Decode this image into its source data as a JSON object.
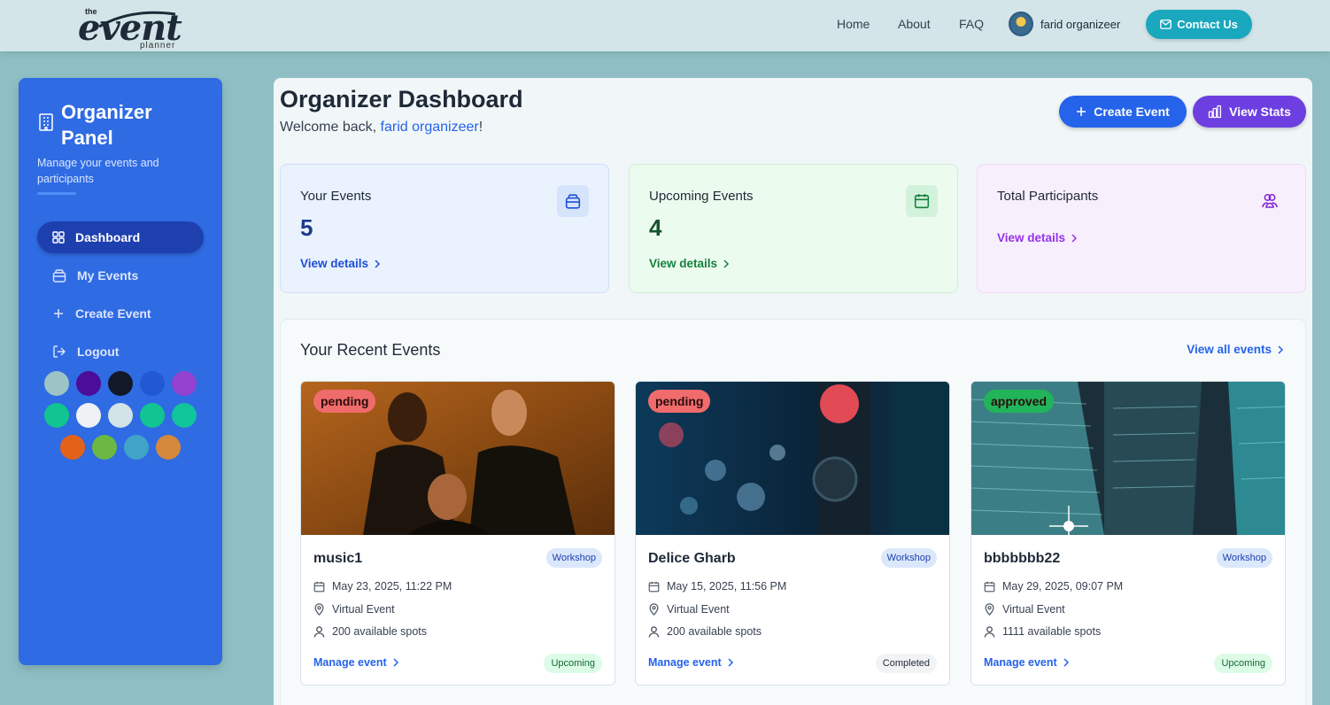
{
  "header": {
    "logo_the": "the",
    "logo_event": "event",
    "logo_planner": "planner",
    "nav": [
      "Home",
      "About",
      "FAQ"
    ],
    "user_name": "farid organizeer",
    "contact_label": "Contact Us"
  },
  "sidebar": {
    "title": "Organizer Panel",
    "subtitle": "Manage your events and participants",
    "items": [
      {
        "label": "Dashboard",
        "icon": "grid-icon",
        "active": true
      },
      {
        "label": "My Events",
        "icon": "bag-icon"
      },
      {
        "label": "Create Event",
        "icon": "plus-icon"
      },
      {
        "label": "Logout",
        "icon": "logout-icon"
      }
    ],
    "swatches": [
      "#9cc4c6",
      "#4b0d9a",
      "#111827",
      "#2158d4",
      "#9442cf",
      "#10c58f",
      "#eef2f5",
      "#d2e3e5",
      "#10c58f",
      "#11c59b",
      "#e4611a",
      "#6cb844",
      "#40a3c8",
      "#d4883b"
    ]
  },
  "main": {
    "title": "Organizer Dashboard",
    "welcome_prefix": "Welcome back, ",
    "welcome_name": "farid organizeer",
    "welcome_suffix": "!",
    "create_btn": "Create Event",
    "stats_btn": "View Stats",
    "stats": [
      {
        "label": "Your Events",
        "value": "5",
        "link": "View details",
        "icon": "bag-icon"
      },
      {
        "label": "Upcoming Events",
        "value": "4",
        "link": "View details",
        "icon": "calendar-icon"
      },
      {
        "label": "Total Participants",
        "value": "",
        "link": "View details",
        "icon": "users-icon"
      }
    ],
    "recent_title": "Your Recent Events",
    "view_all": "View all events",
    "events": [
      {
        "status": "pending",
        "name": "music1",
        "tag": "Workshop",
        "date": "May 23, 2025, 11:22 PM",
        "location": "Virtual Event",
        "spots": "200 available spots",
        "manage": "Manage event",
        "phase": "Upcoming"
      },
      {
        "status": "pending",
        "name": "Delice Gharb",
        "tag": "Workshop",
        "date": "May 15, 2025, 11:56 PM",
        "location": "Virtual Event",
        "spots": "200 available spots",
        "manage": "Manage event",
        "phase": "Completed"
      },
      {
        "status": "approved",
        "name": "bbbbbbb22",
        "tag": "Workshop",
        "date": "May 29, 2025, 09:07 PM",
        "location": "Virtual Event",
        "spots": "1111 available spots",
        "manage": "Manage event",
        "phase": "Upcoming"
      }
    ]
  },
  "colors": {
    "primary": "#2563eb",
    "sidebar": "#2f6be3",
    "purple": "#6d3fe0",
    "teal": "#19a8bd",
    "pending": "#f06b6b",
    "approved": "#22b45a"
  }
}
